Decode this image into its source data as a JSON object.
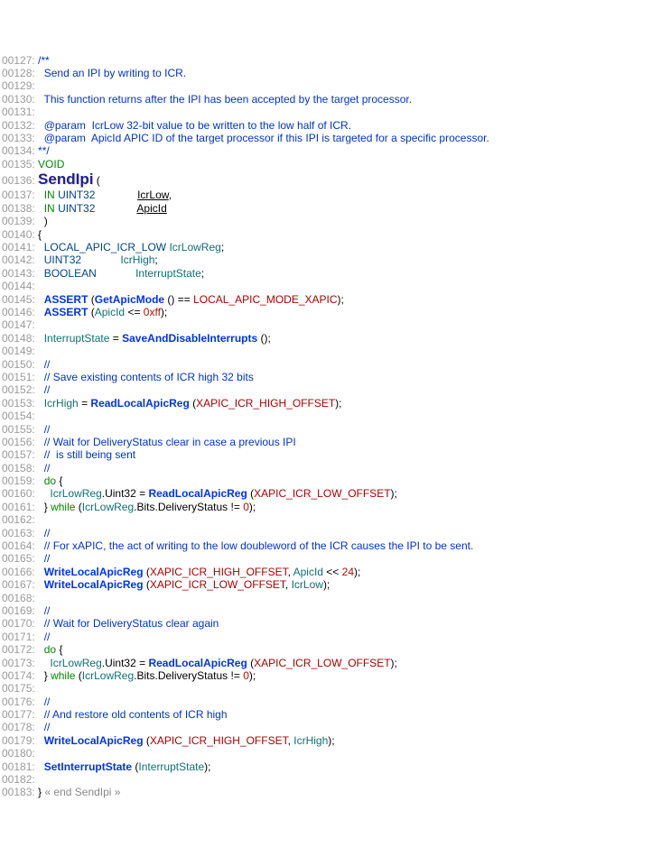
{
  "lines": {
    "n127": "00127:",
    "n128": "00128:",
    "n129": "00129:",
    "n130": "00130:",
    "n131": "00131:",
    "n132": "00132:",
    "n133": "00133:",
    "n134": "00134:",
    "n135": "00135:",
    "n136": "00136:",
    "n137": "00137:",
    "n138": "00138:",
    "n139": "00139:",
    "n140": "00140:",
    "n141": "00141:",
    "n142": "00142:",
    "n143": "00143:",
    "n144": "00144:",
    "n145": "00145:",
    "n146": "00146:",
    "n147": "00147:",
    "n148": "00148:",
    "n149": "00149:",
    "n150": "00150:",
    "n151": "00151:",
    "n152": "00152:",
    "n153": "00153:",
    "n154": "00154:",
    "n155": "00155:",
    "n156": "00156:",
    "n157": "00157:",
    "n158": "00158:",
    "n159": "00159:",
    "n160": "00160:",
    "n161": "00161:",
    "n162": "00162:",
    "n163": "00163:",
    "n164": "00164:",
    "n165": "00165:",
    "n166": "00166:",
    "n167": "00167:",
    "n168": "00168:",
    "n169": "00169:",
    "n170": "00170:",
    "n171": "00171:",
    "n172": "00172:",
    "n173": "00173:",
    "n174": "00174:",
    "n175": "00175:",
    "n176": "00176:",
    "n177": "00177:",
    "n178": "00178:",
    "n179": "00179:",
    "n180": "00180:",
    "n181": "00181:",
    "n182": "00182:",
    "n183": "00183:"
  },
  "doc": {
    "open": "/**",
    "l1": "  Send an IPI by writing to ICR.",
    "blank": "",
    "l2": "  This function returns after the IPI has been accepted by the target processor.",
    "p1a": "  @param  IcrLow 32-bit value to be written to the low half of ICR.",
    "p2a": "  @param  ApicId APIC ID of the target processor if this IPI is targeted for a specific processor.",
    "close": "**/"
  },
  "tok": {
    "void": "VOID",
    "sendipi": "SendIpi",
    "paren_open": " (",
    "in": "IN",
    "uint32": "UINT32",
    "icrlow": "IcrLow",
    "apicid": "ApicId",
    "comma": ",",
    "paren_close": ")",
    "brace_open": "{",
    "brace_close": "}",
    "local_apic": "LOCAL_APIC_ICR_LOW",
    "icrlowreg": "IcrLowReg",
    "semi": ";",
    "uint32b": "UINT32",
    "icrhigh": "IcrHigh",
    "boolean": "BOOLEAN",
    "intstate": "InterruptState",
    "assert": "ASSERT",
    "getapicmode": "GetApicMode",
    "eqeq": " () == ",
    "mode_xapic": "LOCAL_APIC_MODE_XAPIC",
    "close_paren_semi": ");",
    "le_ff": " <= ",
    "xff": "0xff",
    "eq": " = ",
    "savedisable": "SaveAndDisableInterrupts",
    "empty_call": " ();",
    "slashslash": "//",
    "c_save": "// Save existing contents of ICR high 32 bits",
    "readlocal": "ReadLocalApicReg",
    "xapic_high": "XAPIC_ICR_HIGH_OFFSET",
    "c_wait1a": "// Wait for DeliveryStatus clear in case a previous IPI",
    "c_wait1b": "//  is still being sent",
    "do": "do",
    "brace2": " {",
    "dot_uint32": ".Uint32 = ",
    "xapic_low": "XAPIC_ICR_LOW_OFFSET",
    "while": "while",
    "bits": ".Bits.DeliveryStatus != ",
    "zero": "0",
    "c_xapic": "// For xAPIC, the act of writing to the low doubleword of the ICR causes the IPI to be sent.",
    "writelocal": "WriteLocalApicReg",
    "shift": " << ",
    "twentyfour": "24",
    "c_wait2": "// Wait for DeliveryStatus clear again",
    "c_restore": "// And restore old contents of ICR high",
    "setint": "SetInterruptState",
    "endtag": " « end SendIpi »",
    "sp1": " ",
    "sp2": "  ",
    "sp3": "   ",
    "sp4": "    ",
    "pad14": "              ",
    "pad7": "             ",
    "open_p": " (",
    "comma_sp": ", "
  }
}
